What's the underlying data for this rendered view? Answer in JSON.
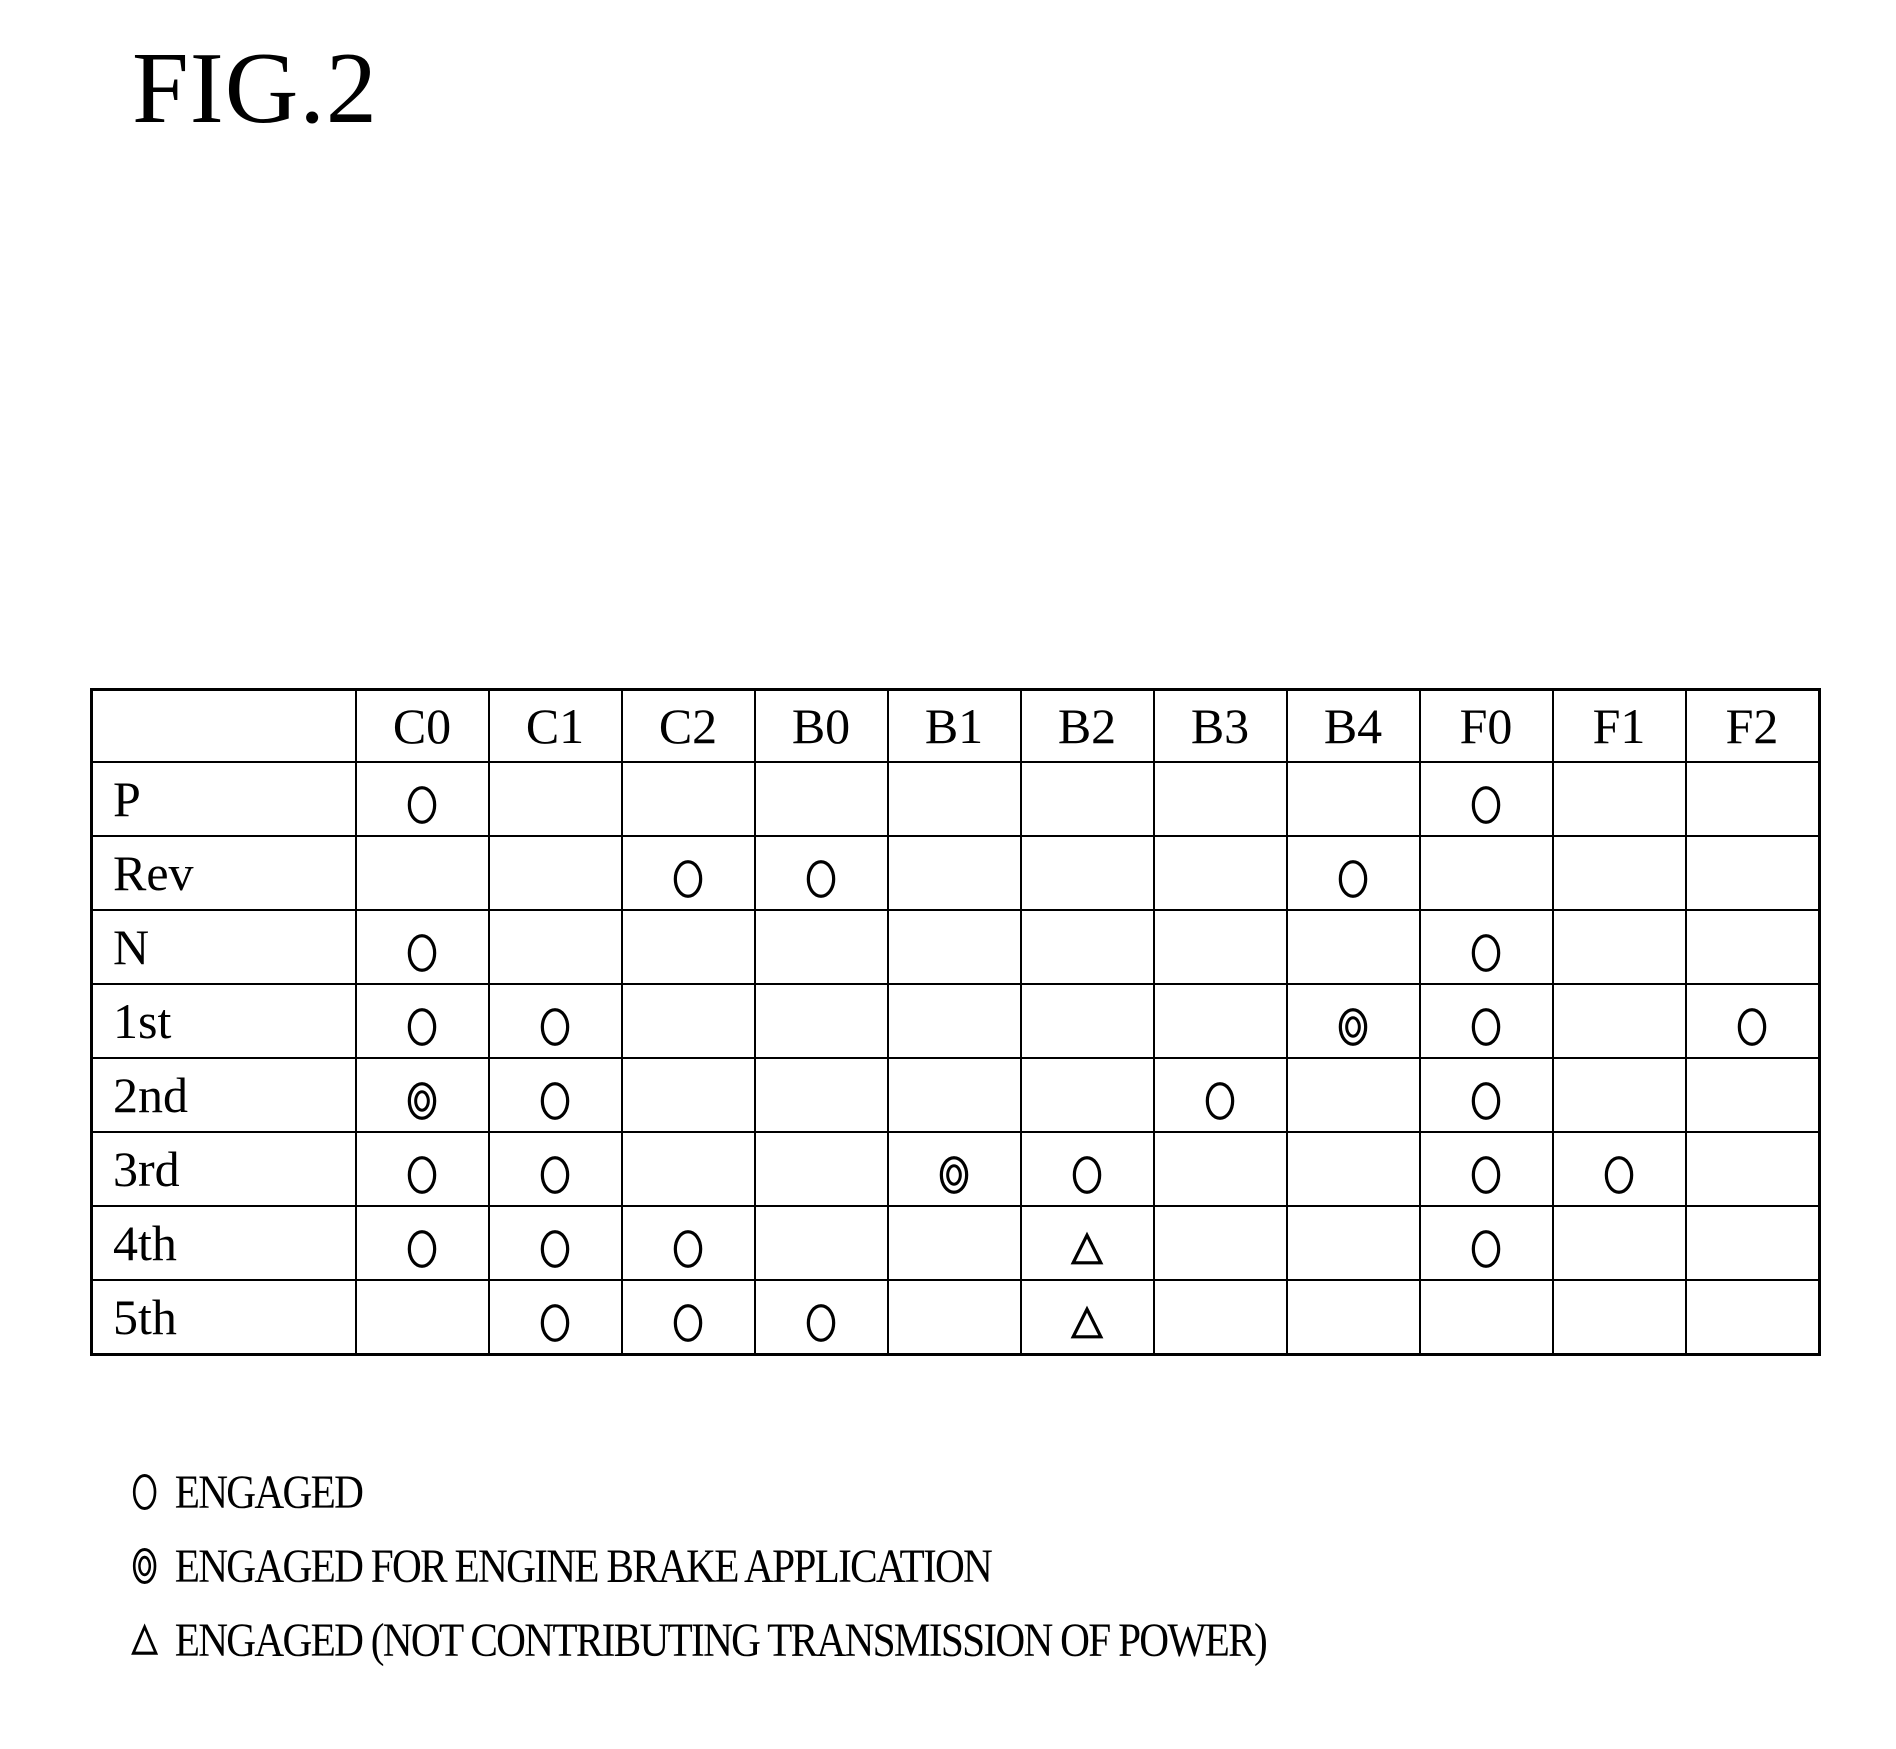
{
  "figure": {
    "title": "FIG.2"
  },
  "table": {
    "columns": [
      "C0",
      "C1",
      "C2",
      "B0",
      "B1",
      "B2",
      "B3",
      "B4",
      "F0",
      "F1",
      "F2"
    ],
    "rows": [
      {
        "label": "P",
        "cells": [
          "engaged",
          "",
          "",
          "",
          "",
          "",
          "",
          "",
          "engaged",
          "",
          ""
        ]
      },
      {
        "label": "Rev",
        "cells": [
          "",
          "",
          "engaged",
          "engaged",
          "",
          "",
          "",
          "engaged",
          "",
          "",
          ""
        ]
      },
      {
        "label": "N",
        "cells": [
          "engaged",
          "",
          "",
          "",
          "",
          "",
          "",
          "",
          "engaged",
          "",
          ""
        ]
      },
      {
        "label": "1st",
        "cells": [
          "engaged",
          "engaged",
          "",
          "",
          "",
          "",
          "",
          "engine-brake",
          "engaged",
          "",
          "engaged"
        ]
      },
      {
        "label": "2nd",
        "cells": [
          "engine-brake",
          "engaged",
          "",
          "",
          "",
          "",
          "engaged",
          "",
          "engaged",
          "",
          ""
        ]
      },
      {
        "label": "3rd",
        "cells": [
          "engaged",
          "engaged",
          "",
          "",
          "engine-brake",
          "engaged",
          "",
          "",
          "engaged",
          "engaged",
          ""
        ]
      },
      {
        "label": "4th",
        "cells": [
          "engaged",
          "engaged",
          "engaged",
          "",
          "",
          "non-contributing",
          "",
          "",
          "engaged",
          "",
          ""
        ]
      },
      {
        "label": "5th",
        "cells": [
          "",
          "engaged",
          "engaged",
          "engaged",
          "",
          "non-contributing",
          "",
          "",
          "",
          "",
          ""
        ]
      }
    ]
  },
  "legend": [
    {
      "symbol": "engaged",
      "icon": "circle-icon",
      "label": "ENGAGED"
    },
    {
      "symbol": "engine-brake",
      "icon": "double-circle-icon",
      "label": "ENGAGED FOR ENGINE BRAKE APPLICATION"
    },
    {
      "symbol": "non-contributing",
      "icon": "triangle-icon",
      "label": "ENGAGED (NOT CONTRIBUTING TRANSMISSION OF POWER)"
    }
  ]
}
